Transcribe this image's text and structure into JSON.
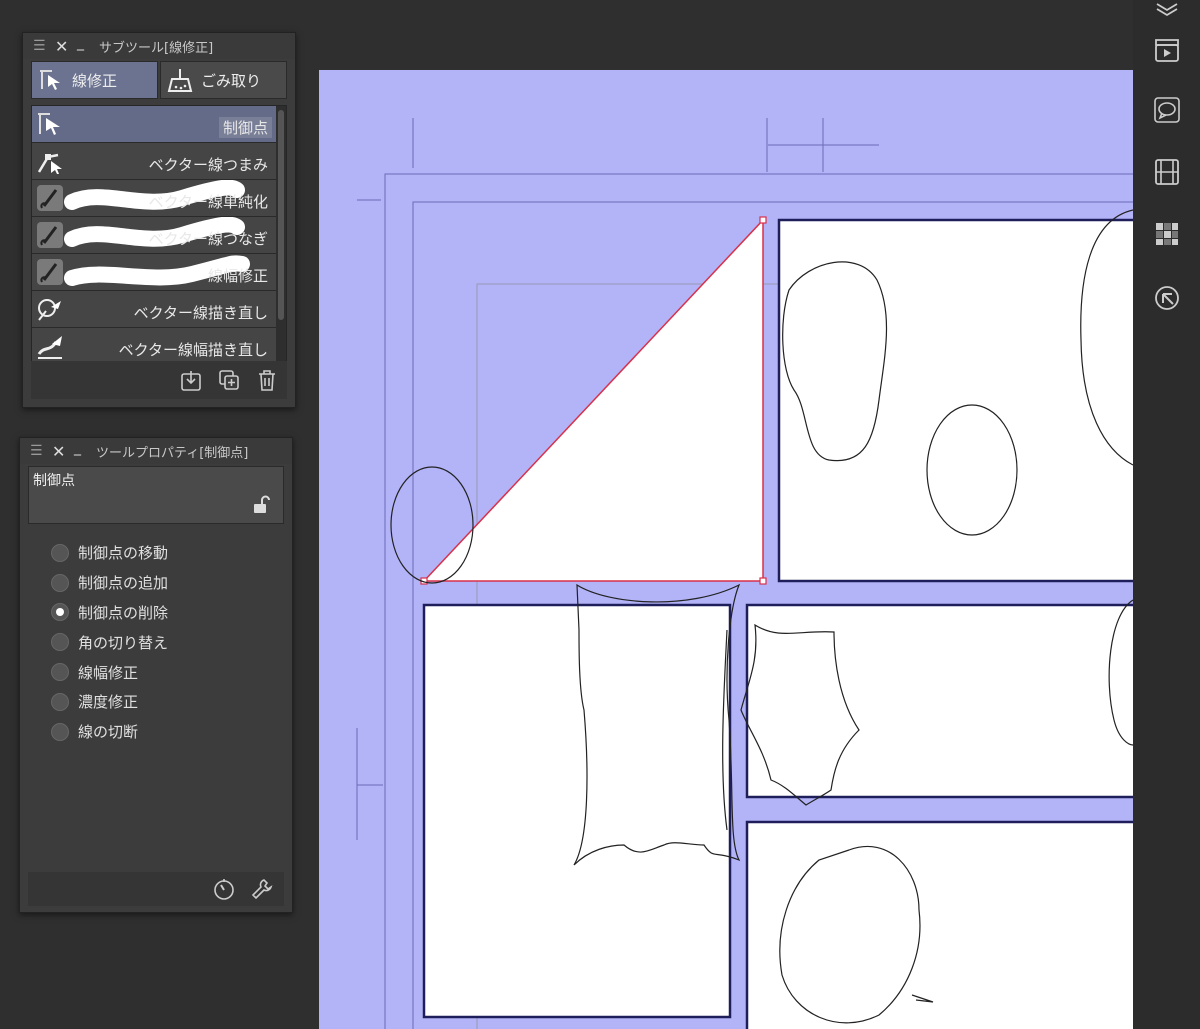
{
  "subtool_panel": {
    "title": "サブツール[線修正]",
    "tabs": [
      {
        "label": "線修正",
        "icon": "control-point-arrow-icon",
        "active": true
      },
      {
        "label": "ごみ取り",
        "icon": "dustpan-icon",
        "active": false
      }
    ],
    "items": [
      {
        "label": "制御点",
        "icon": "control-point-arrow-icon"
      },
      {
        "label": "ベクター線つまみ",
        "icon": "vector-pinch-icon"
      },
      {
        "label": "ベクター線単純化",
        "icon": "brush-stroke-icon"
      },
      {
        "label": "ベクター線つなぎ",
        "icon": "brush-stroke-icon"
      },
      {
        "label": "線幅修正",
        "icon": "brush-stroke-icon"
      },
      {
        "label": "ベクター線描き直し",
        "icon": "redraw-line-icon"
      },
      {
        "label": "ベクター線幅描き直し",
        "icon": "redraw-width-icon"
      }
    ],
    "selected_index": 0,
    "footer_icons": [
      "download-icon",
      "duplicate-icon",
      "trash-icon"
    ]
  },
  "property_panel": {
    "title": "ツールプロパティ[制御点]",
    "header_label": "制御点",
    "lock_icon": "unlock-icon",
    "options": [
      "制御点の移動",
      "制御点の追加",
      "制御点の削除",
      "角の切り替え",
      "線幅修正",
      "濃度修正",
      "線の切断"
    ],
    "selected_index": 2,
    "footer_icons": [
      "dial-icon",
      "wrench-icon"
    ]
  },
  "right_toolbar": {
    "icons": [
      "layers-icon",
      "clapperboard-icon",
      "speech-balloon-icon",
      "film-icon",
      "grid-color-icon",
      "navigator-icon"
    ]
  },
  "colors": {
    "canvas_margin": "#b3b3f7",
    "panel_bg": "#3c3c3c",
    "selected_item": "#646b89",
    "selection_red": "#d9304a",
    "frame_line": "#1e1e5a"
  }
}
